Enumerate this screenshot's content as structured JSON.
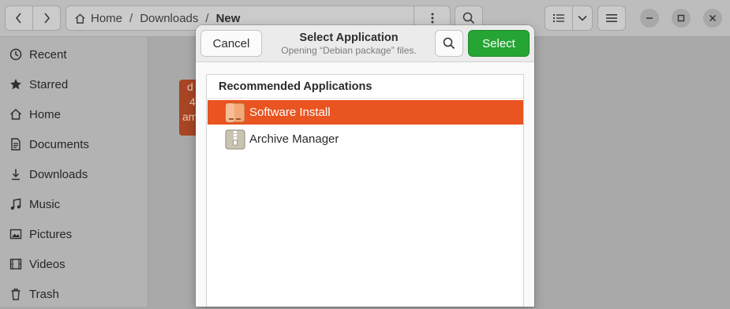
{
  "window": {
    "nav": {
      "back_icon": "chevron-left-icon",
      "forward_icon": "chevron-right-icon"
    },
    "breadcrumb": {
      "home": "Home",
      "downloads": "Downloads",
      "current": "New",
      "separator": "/"
    },
    "toolbar": {
      "menu_icon": "kebab-menu-icon",
      "search_icon": "search-icon",
      "list_view_icon": "list-view-icon",
      "view_options_icon": "chevron-down-icon",
      "main_menu_icon": "hamburger-menu-icon"
    },
    "window_controls": {
      "minimize": "minimize-icon",
      "maximize": "maximize-icon",
      "close": "close-icon"
    }
  },
  "sidebar": {
    "items": [
      {
        "label": "Recent",
        "icon": "clock-icon"
      },
      {
        "label": "Starred",
        "icon": "star-icon"
      },
      {
        "label": "Home",
        "icon": "home-icon"
      },
      {
        "label": "Documents",
        "icon": "document-icon"
      },
      {
        "label": "Downloads",
        "icon": "download-icon"
      },
      {
        "label": "Music",
        "icon": "music-icon"
      },
      {
        "label": "Pictures",
        "icon": "picture-icon"
      },
      {
        "label": "Videos",
        "icon": "video-icon"
      },
      {
        "label": "Trash",
        "icon": "trash-icon"
      }
    ]
  },
  "file_tile": {
    "line1": "d",
    "line2": "4",
    "line3": "am"
  },
  "dialog": {
    "title": "Select Application",
    "subtitle": "Opening “Debian package” files.",
    "cancel_label": "Cancel",
    "select_label": "Select",
    "search_icon": "search-icon",
    "section_title": "Recommended Applications",
    "apps": [
      {
        "label": "Software Install",
        "icon": "software-install-icon",
        "selected": true
      },
      {
        "label": "Archive Manager",
        "icon": "archive-manager-icon",
        "selected": false
      }
    ]
  },
  "colors": {
    "accent": "#e95420",
    "select_button": "#26a534"
  }
}
